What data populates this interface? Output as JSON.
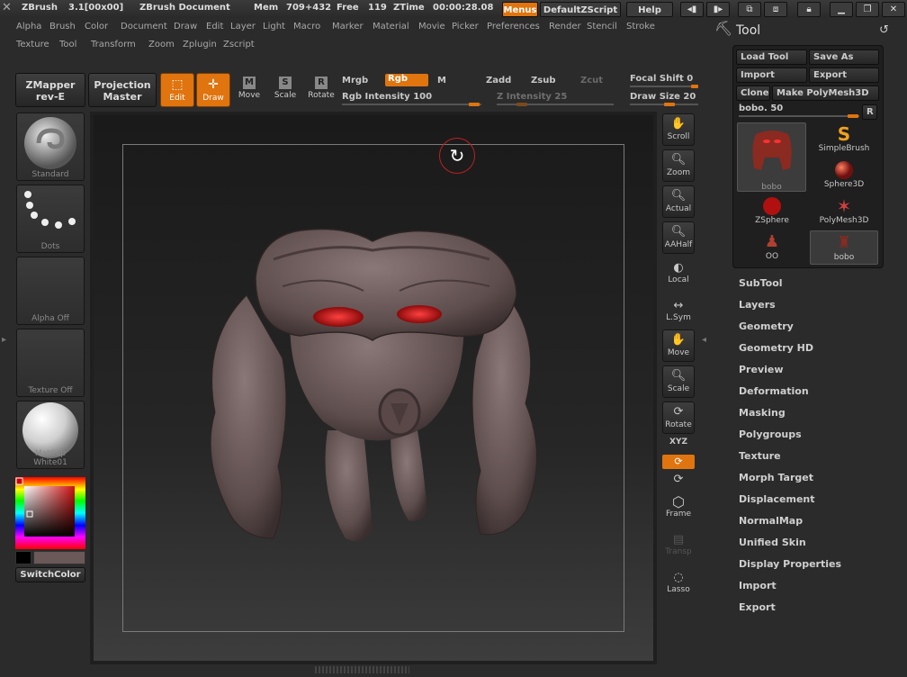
{
  "titlebar": {
    "app": "ZBrush",
    "version": "3.1[00x00]",
    "document": "ZBrush Document",
    "mem_label": "Mem",
    "mem_value": "709+432",
    "free_label": "Free",
    "free_value": "119",
    "ztime_label": "ZTime",
    "ztime_value": "00:00:28.08",
    "menus_btn": "Menus",
    "script_btn": "DefaultZScript",
    "help_btn": "Help"
  },
  "menu_row1": [
    "Alpha",
    "Brush",
    "Color",
    "Document",
    "Draw",
    "Edit",
    "Layer",
    "Light",
    "Macro",
    "Marker",
    "Material",
    "Movie",
    "Picker",
    "Preferences",
    "Render",
    "Stencil",
    "Stroke"
  ],
  "menu_row2": [
    "Texture",
    "Tool",
    "Transform",
    "Zoom",
    "Zplugin",
    "Zscript"
  ],
  "top_shelf": {
    "zmapper": [
      "ZMapper",
      "rev-E"
    ],
    "projection": [
      "Projection",
      "Master"
    ],
    "edit": "Edit",
    "draw": "Draw",
    "move": "Move",
    "scale": "Scale",
    "rotate": "Rotate",
    "move_key": "M",
    "scale_key": "S",
    "rotate_key": "R",
    "mrgb": "Mrgb",
    "rgb": "Rgb",
    "m": "M",
    "zadd": "Zadd",
    "zsub": "Zsub",
    "zcut": "Zcut",
    "rgb_intensity_label": "Rgb Intensity",
    "rgb_intensity_value": "100",
    "z_intensity_label": "Z Intensity",
    "z_intensity_value": "25",
    "focal_shift_label": "Focal Shift",
    "focal_shift_value": "0",
    "draw_size_label": "Draw Size",
    "draw_size_value": "20"
  },
  "left_shelf": {
    "standard": "Standard",
    "dots": "Dots",
    "alpha": "Alpha Off",
    "texture": "Texture Off",
    "matcap": "MatCap White01",
    "switch_color": "SwitchColor"
  },
  "right_shelf": {
    "scroll": "Scroll",
    "zoom": "Zoom",
    "actual": "Actual",
    "aahalf": "AAHalf",
    "local": "Local",
    "lsym": "L.Sym",
    "move": "Move",
    "scale": "Scale",
    "rotate": "Rotate",
    "xyz": "XYZ",
    "frame": "Frame",
    "transp": "Transp",
    "lasso": "Lasso"
  },
  "tool_palette": {
    "title": "Tool",
    "load_tool": "Load Tool",
    "save_as": "Save As",
    "import": "Import",
    "export": "Export",
    "clone": "Clone",
    "make_polymesh": "Make PolyMesh3D",
    "slider_label": "bobo.",
    "slider_value": "50",
    "r_btn": "R",
    "tools": [
      "bobo",
      "SimpleBrush",
      "Sphere3D",
      "ZSphere",
      "PolyMesh3D",
      "OO",
      "bobo"
    ],
    "subpalettes": [
      "SubTool",
      "Layers",
      "Geometry",
      "Geometry HD",
      "Preview",
      "Deformation",
      "Masking",
      "Polygroups",
      "Texture",
      "Morph Target",
      "Displacement",
      "NormalMap",
      "Unified Skin",
      "Display Properties",
      "Import",
      "Export"
    ]
  },
  "colors": {
    "accent": "#e0740e",
    "model": "#6b5858",
    "eye": "#c01818"
  }
}
